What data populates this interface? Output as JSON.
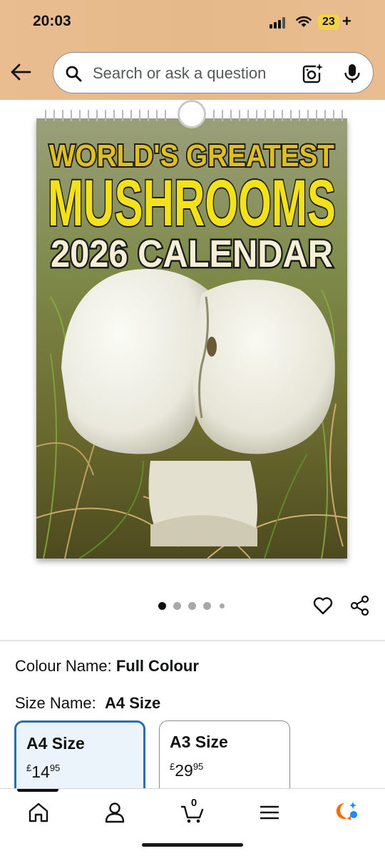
{
  "status_bar": {
    "time": "20:03",
    "battery": "23"
  },
  "search": {
    "placeholder": "Search or ask a question"
  },
  "product_image": {
    "line1": "WORLD'S GREATEST",
    "line2": "MUSHROOMS",
    "line3": "2026 CALENDAR"
  },
  "carousel": {
    "total": 5,
    "active_index": 0
  },
  "attributes": {
    "colour_label": "Colour Name:",
    "colour_value": "Full Colour",
    "size_label": "Size Name:",
    "size_value": "A4 Size"
  },
  "sizes": [
    {
      "name": "A4 Size",
      "currency": "£",
      "whole": "14",
      "fraction": "95",
      "selected": true
    },
    {
      "name": "A3 Size",
      "currency": "£",
      "whole": "29",
      "fraction": "95",
      "selected": false
    }
  ],
  "bottom_nav": {
    "cart_count": "0"
  },
  "colors": {
    "header": "#e9bd90",
    "accent_blue": "#2a6fa8",
    "battery": "#f2d34b",
    "rufus_orange": "#ff6a00",
    "rufus_blue": "#1a8cff"
  }
}
